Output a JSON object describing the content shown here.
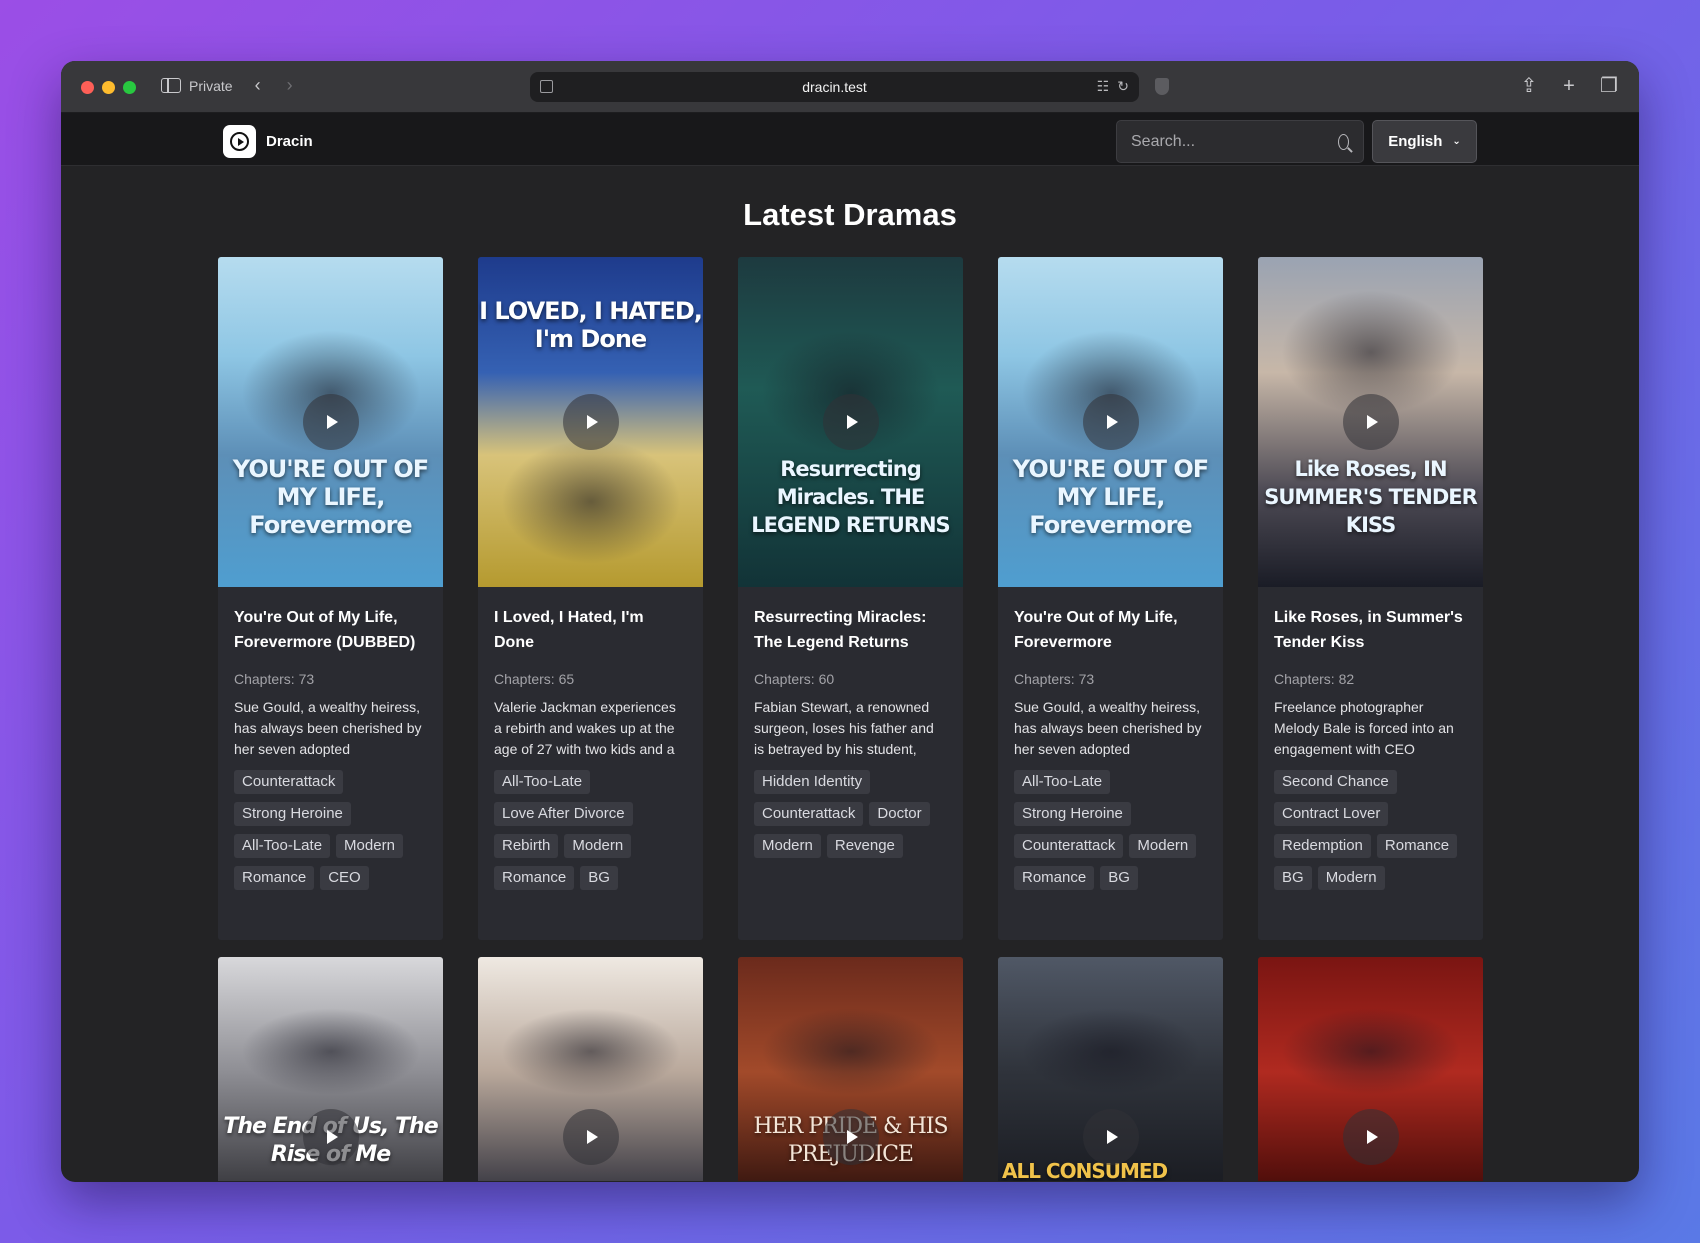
{
  "browser": {
    "mode_label": "Private",
    "url": "dracin.test"
  },
  "app": {
    "brand_name": "Dracin",
    "search_placeholder": "Search...",
    "language": "English"
  },
  "page": {
    "title": "Latest Dramas"
  },
  "dramas": [
    {
      "title": "You're Out of My Life, Forevermore (DUBBED)",
      "poster_text": "YOU'RE OUT OF MY LIFE, Forevermore",
      "chapters": "Chapters: 73",
      "description": "Sue Gould, a wealthy heiress, has always been cherished by her seven adopted",
      "tags": [
        "Counterattack",
        "Strong Heroine",
        "All-Too-Late",
        "Modern",
        "Romance",
        "CEO"
      ]
    },
    {
      "title": "I Loved, I Hated, I'm Done",
      "poster_text": "I LOVED, I HATED, I'm Done",
      "chapters": "Chapters: 65",
      "description": "Valerie Jackman experiences a rebirth and wakes up at the age of 27 with two kids and a",
      "tags": [
        "All-Too-Late",
        "Love After Divorce",
        "Rebirth",
        "Modern",
        "Romance",
        "BG"
      ]
    },
    {
      "title": "Resurrecting Miracles: The Legend Returns",
      "poster_text": "Resurrecting Miracles. THE LEGEND RETURNS",
      "chapters": "Chapters: 60",
      "description": "Fabian Stewart, a renowned surgeon, loses his father and is betrayed by his student,",
      "tags": [
        "Hidden Identity",
        "Counterattack",
        "Doctor",
        "Modern",
        "Revenge"
      ]
    },
    {
      "title": "You're Out of My Life, Forevermore",
      "poster_text": "YOU'RE OUT OF MY LIFE, Forevermore",
      "chapters": "Chapters: 73",
      "description": "Sue Gould, a wealthy heiress, has always been cherished by her seven adopted",
      "tags": [
        "All-Too-Late",
        "Strong Heroine",
        "Counterattack",
        "Modern",
        "Romance",
        "BG"
      ]
    },
    {
      "title": "Like Roses, in Summer's Tender Kiss",
      "poster_text": "Like Roses, IN SUMMER'S TENDER KISS",
      "chapters": "Chapters: 82",
      "description": "Freelance photographer Melody Bale is forced into an engagement with CEO",
      "tags": [
        "Second Chance",
        "Contract Lover",
        "Redemption",
        "Romance",
        "BG",
        "Modern"
      ]
    }
  ],
  "dramas_row2": [
    {
      "poster_text": "The End of Us, The Rise of Me"
    },
    {
      "poster_text": ""
    },
    {
      "poster_text": "HER PRIDE & HIS PREJUDICE"
    },
    {
      "poster_text": "ALL CONSUMED"
    },
    {
      "poster_text": ""
    }
  ]
}
